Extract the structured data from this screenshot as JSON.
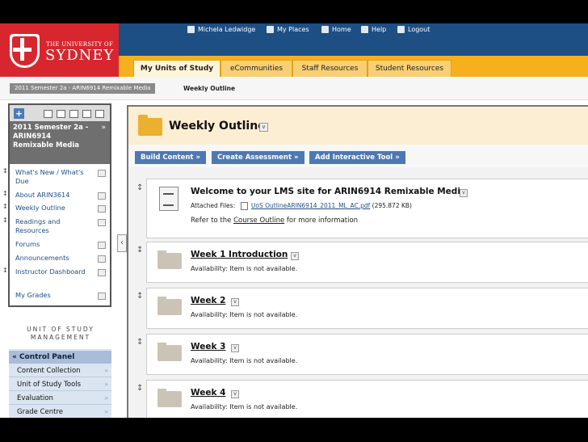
{
  "header": {
    "university_small": "THE UNIVERSITY OF",
    "university_big": "SYDNEY",
    "top_links": [
      "Michela Ledwidge",
      "My Places",
      "Home",
      "Help",
      "Logout"
    ],
    "tabs": [
      "My Units of Study",
      "eCommunities",
      "Staff Resources",
      "Student Resources"
    ]
  },
  "breadcrumb": {
    "course": "2011 Semester 2a - ARIN6914 Remixable Media",
    "page": "Weekly Outline"
  },
  "sidebar": {
    "course_title": "2011 Semester 2a - ARIN6914 Remixable Media",
    "items": [
      "What's New / What's Due",
      "About ARIN3614",
      "Weekly Outline",
      "Readings and Resources",
      "Forums",
      "Announcements",
      "Instructor Dashboard",
      "My Grades"
    ],
    "management_label": "UNIT OF STUDY MANAGEMENT",
    "control_panel": {
      "title": "Control Panel",
      "items": [
        "Content Collection",
        "Unit of Study Tools",
        "Evaluation",
        "Grade Centre"
      ]
    }
  },
  "main": {
    "title": "Weekly Outline",
    "actions": [
      "Build Content",
      "Create Assessment",
      "Add Interactive Tool"
    ],
    "welcome": {
      "title": "Welcome to your LMS site for ARIN6914 Remixable Media",
      "attached_label": "Attached Files:",
      "file_name": "UoS OutlineARIN6914_2011_ML_AC.pdf",
      "file_size": "(295.872 KB)",
      "refer_prefix": "Refer to the",
      "refer_link": "Course Outline",
      "refer_suffix": "for more information"
    },
    "weeks": [
      {
        "title": "Week 1 Introduction",
        "availability": "Availability: Item is not available."
      },
      {
        "title": "Week 2",
        "availability": "Availability: Item is not available."
      },
      {
        "title": "Week 3",
        "availability": "Availability: Item is not available."
      },
      {
        "title": "Week 4",
        "availability": "Availability: Item is not available."
      }
    ]
  },
  "colors": {
    "brand_red": "#d8262e",
    "nav_blue": "#1d4e84",
    "tab_gold": "#f5b11d",
    "action_blue": "#4e78b1"
  }
}
